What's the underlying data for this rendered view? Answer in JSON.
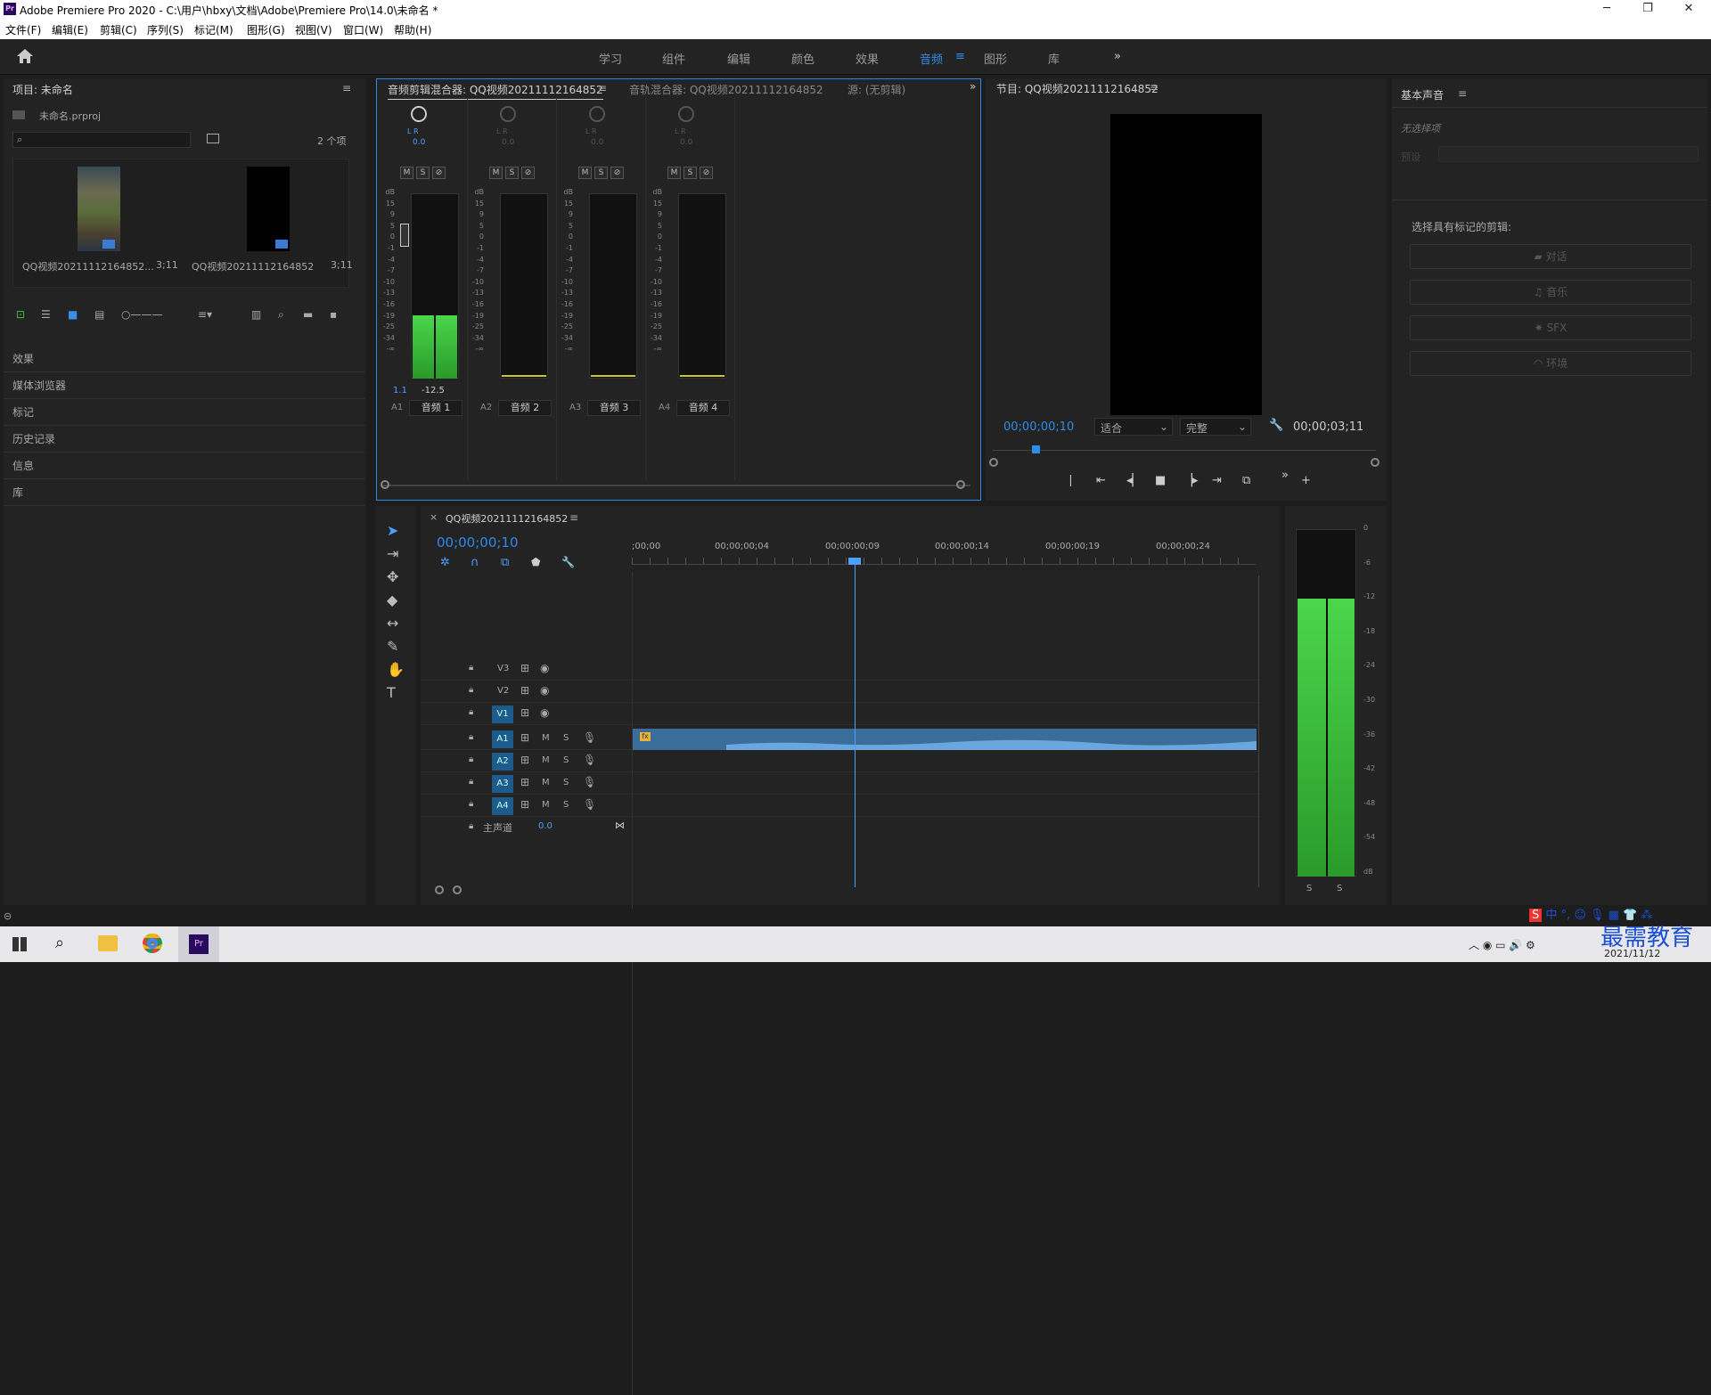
{
  "window": {
    "title": "Adobe Premiere Pro 2020 - C:\\用户\\hbxy\\文档\\Adobe\\Premiere Pro\\14.0\\未命名 *",
    "minimize": "─",
    "maximize": "❐",
    "close": "✕"
  },
  "menu": [
    "文件(F)",
    "编辑(E)",
    "剪辑(C)",
    "序列(S)",
    "标记(M)",
    "图形(G)",
    "视图(V)",
    "窗口(W)",
    "帮助(H)"
  ],
  "workspaces": [
    "学习",
    "组件",
    "编辑",
    "颜色",
    "效果",
    "音频",
    "图形",
    "库"
  ],
  "workspace_active": "音频",
  "project": {
    "title": "项目: 未命名",
    "file": "未命名.prproj",
    "count": "2 个项",
    "items": [
      {
        "name": "QQ视频20211112164852...",
        "dur": "3;11"
      },
      {
        "name": "QQ视频20211112164852",
        "dur": "3;11"
      }
    ]
  },
  "left_panels": [
    "效果",
    "媒体浏览器",
    "标记",
    "历史记录",
    "信息",
    "库"
  ],
  "mixer": {
    "tabs": [
      "音频剪辑混合器: QQ视频20211112164852",
      "音轨混合器: QQ视频20211112164852",
      "源: (无剪辑)"
    ],
    "lr": "L    R",
    "channels": [
      {
        "id": "A1",
        "name": "音频 1",
        "pan": "0.0",
        "vol": "1.1",
        "peak": "-12.5",
        "level": 0.34
      },
      {
        "id": "A2",
        "name": "音频 2",
        "pan": "0.0",
        "vol": "",
        "peak": "",
        "level": 0
      },
      {
        "id": "A3",
        "name": "音频 3",
        "pan": "0.0",
        "vol": "",
        "peak": "",
        "level": 0
      },
      {
        "id": "A4",
        "name": "音频 4",
        "pan": "0.0",
        "vol": "",
        "peak": "",
        "level": 0
      }
    ],
    "scale": [
      "dB",
      "15",
      "9",
      "5",
      "0",
      "-1",
      "-4",
      "-7",
      "-10",
      "-13",
      "-16",
      "-19",
      "-25",
      "-34",
      "-∞"
    ],
    "msr": [
      "M",
      "S",
      "⊘"
    ]
  },
  "program": {
    "title": "节目: QQ视频20211112164852",
    "timecode": "00;00;00;10",
    "fit": "适合",
    "quality": "完整",
    "duration": "00;00;03;11"
  },
  "essential_sound": {
    "title": "基本声音",
    "no_selection": "无选择项",
    "preset": "预设",
    "prompt": "选择具有标记的剪辑:",
    "buttons": [
      "对话",
      "音乐",
      "SFX",
      "环境"
    ]
  },
  "timeline": {
    "title": "QQ视频20211112164852",
    "timecode": "00;00;00;10",
    "ruler": [
      ";00;00",
      "00;00;00;04",
      "00;00;00;09",
      "00;00;00;14",
      "00;00;00;19",
      "00;00;00;24"
    ],
    "video_tracks": [
      "V3",
      "V2",
      "V1"
    ],
    "audio_tracks": [
      "A1",
      "A2",
      "A3",
      "A4"
    ],
    "master": "主声道",
    "master_val": "0.0",
    "m": "M",
    "s": "S"
  },
  "master_meter": {
    "scale": [
      "0",
      "-6",
      "-12",
      "-18",
      "-24",
      "-30",
      "-36",
      "-42",
      "-48",
      "-54",
      "dB"
    ],
    "level": 0.8,
    "s": "S"
  },
  "taskbar": {
    "date": "2021/11/12",
    "ime": "中",
    "watermark": "最需教育"
  },
  "colors": {
    "accent": "#2d8ceb",
    "panel": "#232323",
    "meter": "#3fc03f"
  }
}
